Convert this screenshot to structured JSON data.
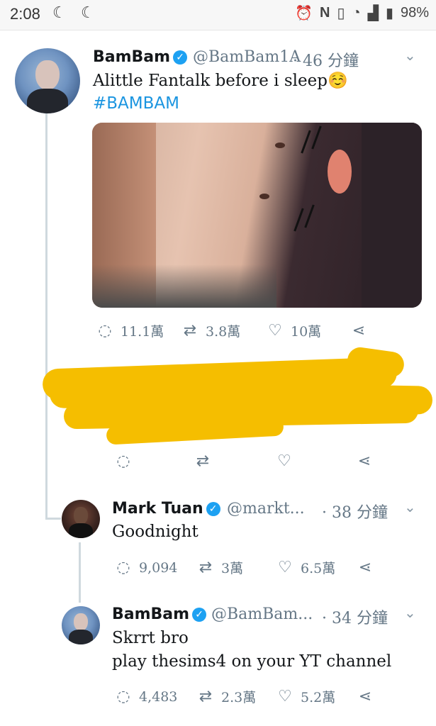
{
  "status_bar": {
    "time": "2:08",
    "battery": "98%"
  },
  "tweets": [
    {
      "name": "BamBam",
      "handle": "@BamBam1A",
      "time": "· 46 分鐘",
      "text": "Alittle Fantalk before i sleep☺️",
      "hashtag": "#BAMBAM",
      "actions": {
        "replies": "11.1萬",
        "retweets": "3.8萬",
        "likes": "10萬"
      }
    },
    {
      "name": "Mark Tuan",
      "handle": "@markt...",
      "time": "· 38 分鐘",
      "text": "Goodnight",
      "actions": {
        "replies": "9,094",
        "retweets": "3萬",
        "likes": "6.5萬"
      }
    },
    {
      "name": "BamBam",
      "handle": "@BamBam...",
      "time": "· 34 分鐘",
      "text1": "Skrrt bro",
      "text2": "play thesims4 on your YT channel",
      "actions": {
        "replies": "4,483",
        "retweets": "2.3萬",
        "likes": "5.2萬"
      }
    }
  ],
  "colors": {
    "link": "#1b95e0",
    "verified": "#1da1f2",
    "redaction": "#f5be00"
  }
}
